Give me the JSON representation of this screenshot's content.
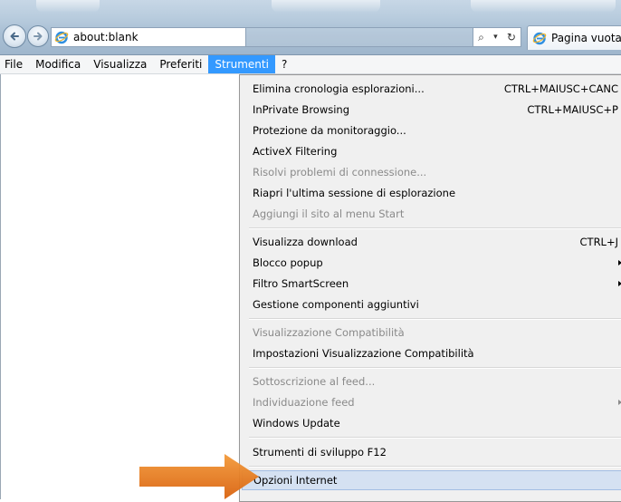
{
  "window": {
    "address_url": "about:blank",
    "tab_title": "Pagina vuota",
    "search_glyph": "⌕",
    "dropdown_glyph": "▾",
    "refresh_glyph": "↻"
  },
  "menubar": {
    "items": [
      {
        "label": "File"
      },
      {
        "label": "Modifica"
      },
      {
        "label": "Visualizza"
      },
      {
        "label": "Preferiti"
      },
      {
        "label": "Strumenti",
        "active": true
      },
      {
        "label": "?"
      }
    ]
  },
  "tools_menu": {
    "items": [
      {
        "label": "Elimina cronologia esplorazioni...",
        "shortcut": "CTRL+MAIUSC+CANC"
      },
      {
        "label": "InPrivate Browsing",
        "shortcut": "CTRL+MAIUSC+P"
      },
      {
        "label": "Protezione da monitoraggio..."
      },
      {
        "label": "ActiveX Filtering"
      },
      {
        "label": "Risolvi problemi di connessione...",
        "disabled": true
      },
      {
        "label": "Riapri l'ultima sessione di esplorazione"
      },
      {
        "label": "Aggiungi il sito al menu Start",
        "disabled": true
      },
      {
        "label": "Visualizza download",
        "shortcut": "CTRL+J"
      },
      {
        "label": "Blocco popup",
        "submenu": true
      },
      {
        "label": "Filtro SmartScreen",
        "submenu": true
      },
      {
        "label": "Gestione componenti aggiuntivi"
      },
      {
        "label": "Visualizzazione Compatibilità",
        "disabled": true
      },
      {
        "label": "Impostazioni Visualizzazione Compatibilità"
      },
      {
        "label": "Sottoscrizione al feed...",
        "disabled": true
      },
      {
        "label": "Individuazione feed",
        "disabled": true,
        "submenu": true
      },
      {
        "label": "Windows Update"
      },
      {
        "label": "Strumenti di sviluppo F12"
      },
      {
        "label": "Opzioni Internet",
        "highlighted": true
      }
    ]
  },
  "colors": {
    "menu_active": "#3399ff",
    "menu_highlight": "#d5e1f2",
    "annotation_arrow": "#e8731c"
  },
  "icons": [
    "back-arrow-icon",
    "forward-arrow-icon",
    "ie-logo-icon",
    "search-icon",
    "refresh-icon",
    "submenu-arrow-icon",
    "pointer-arrow-icon"
  ]
}
